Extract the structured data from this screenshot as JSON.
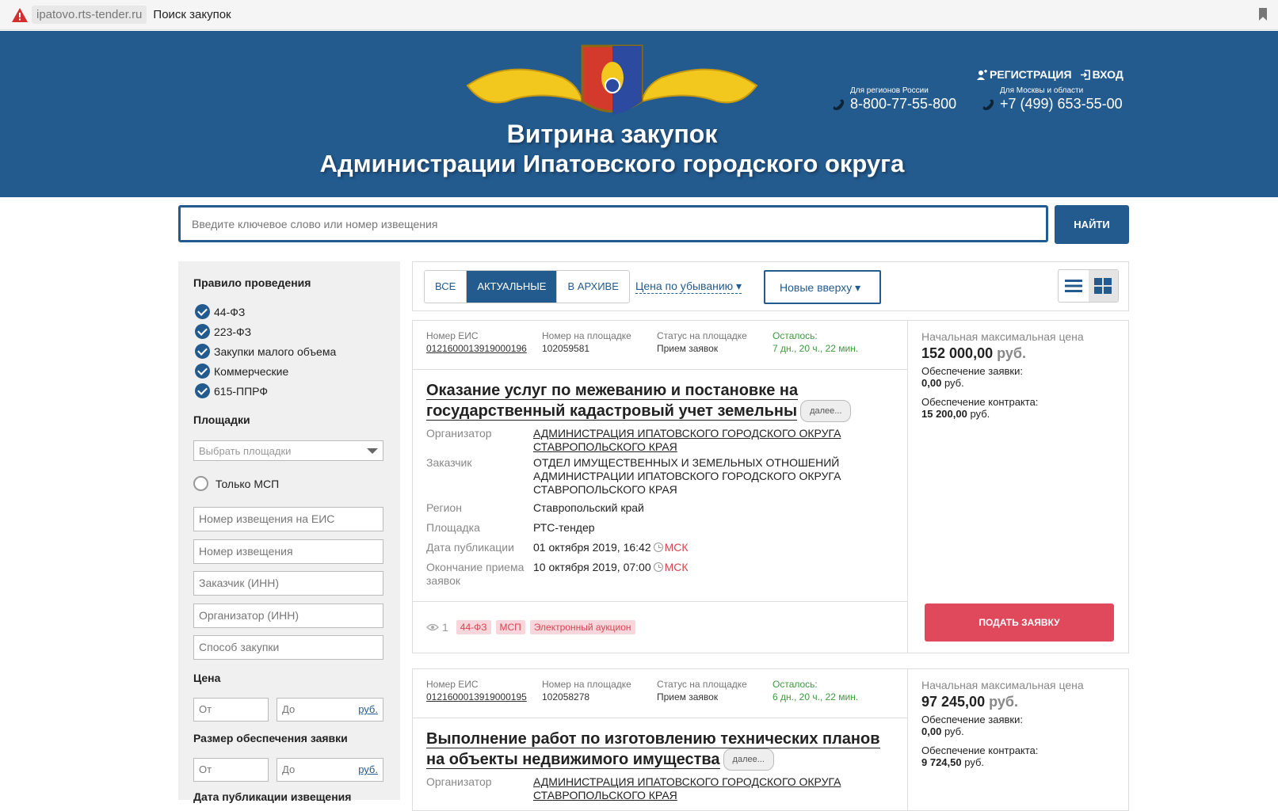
{
  "browser": {
    "url": "ipatovo.rts-tender.ru",
    "page_title": "Поиск закупок"
  },
  "header": {
    "title_line1": "Витрина закупок",
    "title_line2": "Администрации Ипатовского городского округа",
    "register_label": "РЕГИСТРАЦИЯ",
    "login_label": "ВХОД",
    "phones": [
      {
        "caption": "Для регионов России",
        "number": "8-800-77-55-800"
      },
      {
        "caption": "Для Москвы и области",
        "number": "+7 (499) 653-55-00"
      }
    ],
    "colors": {
      "header_bg": "#235b8e",
      "accent_red": "#e0485b"
    }
  },
  "search": {
    "placeholder": "Введите ключевое слово или номер извещения",
    "button_label": "НАЙТИ"
  },
  "filters": {
    "rule_heading": "Правило проведения",
    "rules": [
      "44-ФЗ",
      "223-ФЗ",
      "Закупки малого объема",
      "Коммерческие",
      "615-ППРФ"
    ],
    "platforms_heading": "Площадки",
    "platforms_placeholder": "Выбрать площадки",
    "only_msp_label": "Только МСП",
    "eis_number_placeholder": "Номер извещения на ЕИС",
    "notice_number_placeholder": "Номер извещения",
    "customer_inn_placeholder": "Заказчик (ИНН)",
    "organizer_inn_placeholder": "Организатор (ИНН)",
    "method_placeholder": "Способ закупки",
    "price_heading": "Цена",
    "from_placeholder": "От",
    "to_placeholder": "До",
    "currency": "руб.",
    "guarantee_heading": "Размер обеспечения заявки",
    "date_heading": "Дата публикации извещения"
  },
  "toolbar": {
    "tabs": [
      "ВСЕ",
      "АКТУАЛЬНЫЕ",
      "В АРХИВЕ"
    ],
    "active_tab": "АКТУАЛЬНЫЕ",
    "price_sort": "Цена по убыванию",
    "date_sort": "Новые вверху",
    "views": [
      "list-view-icon",
      "grid-view-icon"
    ]
  },
  "labels": {
    "eis": "Номер ЕИС",
    "platform_number": "Номер на площадке",
    "status": "Статус на площадке",
    "left": "Осталось:",
    "organizer": "Организатор",
    "customer": "Заказчик",
    "region": "Регион",
    "platform": "Площадка",
    "pub_date": "Дата публикации",
    "end_date": "Окончание приема заявок",
    "more": "далее...",
    "msk": "МСК",
    "nmc": "Начальная максимальная цена",
    "bid_guarantee": "Обеспечение заявки:",
    "contract_guarantee": "Обеспечение контракта:",
    "rub": "руб.",
    "apply": "ПОДАТЬ ЗАЯВКУ"
  },
  "tenders": [
    {
      "eis": "0121600013919000196",
      "platform_number": "102059581",
      "status": "Прием заявок",
      "left": "7 дн., 20 ч., 22 мин.",
      "title": "Оказание услуг по межеванию и постановке на государственный кадастровый учет земельны",
      "organizer_line1": "АДМИНИСТРАЦИЯ ИПАТОВСКОГО ГОРОДСКОГО ОКРУГА",
      "organizer_line2": "СТАВРОПОЛЬСКОГО КРАЯ",
      "customer_line1": "ОТДЕЛ ИМУЩЕСТВЕННЫХ И ЗЕМЕЛЬНЫХ ОТНОШЕНИЙ",
      "customer_line2": "АДМИНИСТРАЦИИ ИПАТОВСКОГО ГОРОДСКОГО ОКРУГА",
      "customer_line3": "СТАВРОПОЛЬСКОГО КРАЯ",
      "region": "Ставропольский край",
      "platform": "РТС-тендер",
      "pub_date": "01 октября 2019, 16:42",
      "end_date": "10 октября 2019, 07:00",
      "views": "1",
      "tags": [
        "44-ФЗ",
        "МСП",
        "Электронный аукцион"
      ],
      "price": "152 000,00",
      "bid_guarantee": "0,00",
      "contract_guarantee": "15 200,00"
    },
    {
      "eis": "0121600013919000195",
      "platform_number": "102058278",
      "status": "Прием заявок",
      "left": "6 дн., 20 ч., 22 мин.",
      "title": "Выполнение работ по изготовлению технических планов на объекты недвижимого имущества",
      "organizer_line1": "АДМИНИСТРАЦИЯ ИПАТОВСКОГО ГОРОДСКОГО ОКРУГА",
      "organizer_line2": "СТАВРОПОЛЬСКОГО КРАЯ",
      "price": "97 245,00",
      "bid_guarantee": "0,00",
      "contract_guarantee": "9 724,50"
    }
  ]
}
